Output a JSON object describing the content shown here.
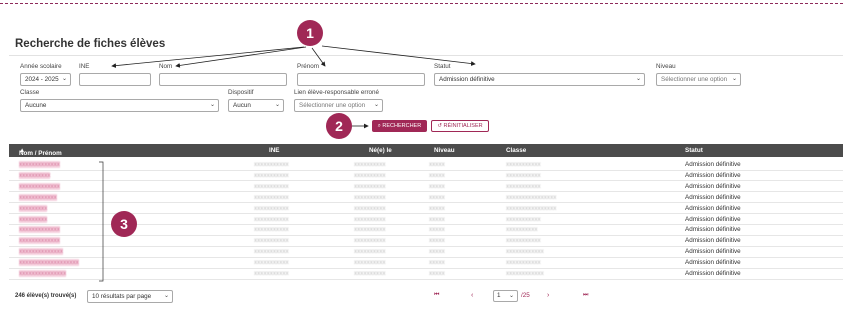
{
  "title": "Recherche de fiches élèves",
  "filters": {
    "annee_label": "Année scolaire",
    "annee_value": "2024 - 2025",
    "ine_label": "INE",
    "nom_label": "Nom",
    "prenom_label": "Prénom",
    "statut_label": "Statut",
    "statut_value": "Admission définitive",
    "niveau_label": "Niveau",
    "niveau_placeholder": "Sélectionner une option",
    "classe_label": "Classe",
    "classe_value": "Aucune",
    "dispositif_label": "Dispositif",
    "dispositif_value": "Aucun",
    "lien_label": "Lien élève-responsable erroné",
    "lien_placeholder": "Sélectionner une option"
  },
  "buttons": {
    "search": "RECHERCHER",
    "reset": "RÉINITIALISER"
  },
  "table": {
    "headers": {
      "nom": "Nom / Prénom",
      "ine": "INE",
      "ne_le": "Né(e) le",
      "niveau": "Niveau",
      "classe": "Classe",
      "statut": "Statut"
    },
    "rows": [
      {
        "nom": "xxxxxxxxxxxxx",
        "ine": "xxxxxxxxxxx",
        "ne_le": "xxxxxxxxxx",
        "niveau": "xxxxx",
        "classe": "xxxxxxxxxxx",
        "statut": "Admission définitive"
      },
      {
        "nom": "xxxxxxxxxx",
        "ine": "xxxxxxxxxxx",
        "ne_le": "xxxxxxxxxx",
        "niveau": "xxxxx",
        "classe": "xxxxxxxxxxx",
        "statut": "Admission définitive"
      },
      {
        "nom": "xxxxxxxxxxxxx",
        "ine": "xxxxxxxxxxx",
        "ne_le": "xxxxxxxxxx",
        "niveau": "xxxxx",
        "classe": "xxxxxxxxxxx",
        "statut": "Admission définitive"
      },
      {
        "nom": "xxxxxxxxxxxx",
        "ine": "xxxxxxxxxxx",
        "ne_le": "xxxxxxxxxx",
        "niveau": "xxxxx",
        "classe": "xxxxxxxxxxxxxxxx",
        "statut": "Admission définitive"
      },
      {
        "nom": "xxxxxxxxx",
        "ine": "xxxxxxxxxxx",
        "ne_le": "xxxxxxxxxx",
        "niveau": "xxxxx",
        "classe": "xxxxxxxxxxxxxxxx",
        "statut": "Admission définitive"
      },
      {
        "nom": "xxxxxxxxx",
        "ine": "xxxxxxxxxxx",
        "ne_le": "xxxxxxxxxx",
        "niveau": "xxxxx",
        "classe": "xxxxxxxxxxx",
        "statut": "Admission définitive"
      },
      {
        "nom": "xxxxxxxxxxxxx",
        "ine": "xxxxxxxxxxx",
        "ne_le": "xxxxxxxxxx",
        "niveau": "xxxxx",
        "classe": "xxxxxxxxxx",
        "statut": "Admission définitive"
      },
      {
        "nom": "xxxxxxxxxxxxx",
        "ine": "xxxxxxxxxxx",
        "ne_le": "xxxxxxxxxx",
        "niveau": "xxxxx",
        "classe": "xxxxxxxxxxx",
        "statut": "Admission définitive"
      },
      {
        "nom": "xxxxxxxxxxxxxx",
        "ine": "xxxxxxxxxxx",
        "ne_le": "xxxxxxxxxx",
        "niveau": "xxxxx",
        "classe": "xxxxxxxxxxxx",
        "statut": "Admission définitive"
      },
      {
        "nom": "xxxxxxxxxxxxxxxxxxx",
        "ine": "xxxxxxxxxxx",
        "ne_le": "xxxxxxxxxx",
        "niveau": "xxxxx",
        "classe": "xxxxxxxxxxx",
        "statut": "Admission définitive"
      },
      {
        "nom": "xxxxxxxxxxxxxxx",
        "ine": "xxxxxxxxxxx",
        "ne_le": "xxxxxxxxxx",
        "niveau": "xxxxx",
        "classe": "xxxxxxxxxxxx",
        "statut": "Admission définitive"
      }
    ]
  },
  "footer": {
    "count": "246 élève(s) trouvé(s)",
    "per_page": "10 résultats par page",
    "first": "⏮",
    "prev": "‹",
    "page": "1",
    "total": "/25",
    "next": "›",
    "last": "⏭"
  },
  "annotations": {
    "badge1": "1",
    "badge2": "2",
    "badge3": "3"
  },
  "colors": {
    "accent": "#a02856",
    "table_header": "#4c4c4c"
  }
}
